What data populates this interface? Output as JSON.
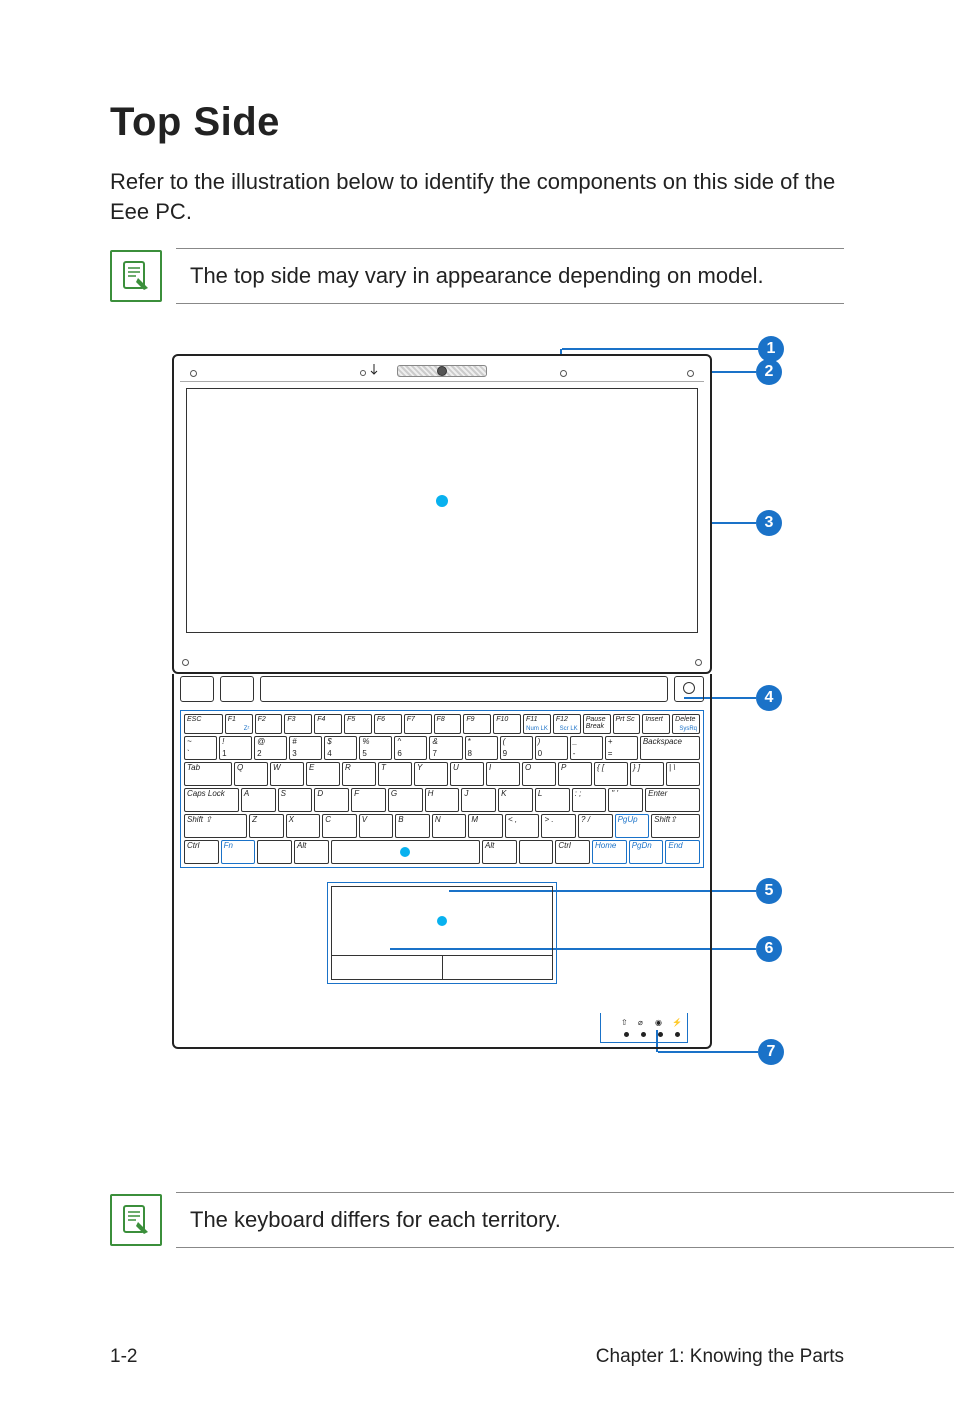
{
  "heading": "Top Side",
  "intro": "Refer to the illustration below to identify the components on this side of the Eee PC.",
  "note_top": "The top side may vary in appearance depending on model.",
  "note_bottom": "The keyboard differs for each territory.",
  "callouts": {
    "c1": "1",
    "c2": "2",
    "c3": "3",
    "c4": "4",
    "c5": "5",
    "c6": "6",
    "c7": "7"
  },
  "keyboard": {
    "row_fn": [
      "ESC",
      "F1",
      "F2",
      "F3",
      "F4",
      "F5",
      "F6",
      "F7",
      "F8",
      "F9",
      "F10",
      "F11",
      "F12",
      "Pause Break",
      "Prt Sc",
      "Insert",
      "Delete"
    ],
    "row_num_upper": [
      "~",
      "!",
      "@",
      "#",
      "$",
      "%",
      "^",
      "&",
      "*",
      "(",
      ")",
      "_",
      "+"
    ],
    "row_num_lower": [
      "`",
      "1",
      "2",
      "3",
      "4",
      "5",
      "6",
      "7",
      "8",
      "9",
      "0",
      "-",
      "="
    ],
    "row_num_right": "Backspace",
    "row_q": [
      "Tab",
      "Q",
      "W",
      "E",
      "R",
      "T",
      "Y",
      "U",
      "I",
      "O",
      "P",
      "{ [",
      "} ]",
      "| \\"
    ],
    "row_a": [
      "Caps Lock",
      "A",
      "S",
      "D",
      "F",
      "G",
      "H",
      "J",
      "K",
      "L",
      ": ;",
      "\" '",
      "Enter"
    ],
    "row_z": [
      "Shift ⇧",
      "Z",
      "X",
      "C",
      "V",
      "B",
      "N",
      "M",
      "< ,",
      "> .",
      "? /",
      "PgUp",
      "Shift⇧"
    ],
    "row_ctrl": [
      "Ctrl",
      "Fn",
      "",
      "Alt",
      "",
      "Alt",
      "",
      "Ctrl",
      "Home",
      "PgDn",
      "End"
    ],
    "fn_sub": [
      "",
      "Zᶻ",
      "",
      "",
      "",
      "",
      "",
      "",
      "",
      "",
      "",
      "Num LK",
      "Scr LK",
      "",
      "",
      "",
      "SysRq"
    ]
  },
  "footer": {
    "left": "1-2",
    "right": "Chapter 1: Knowing the Parts"
  }
}
